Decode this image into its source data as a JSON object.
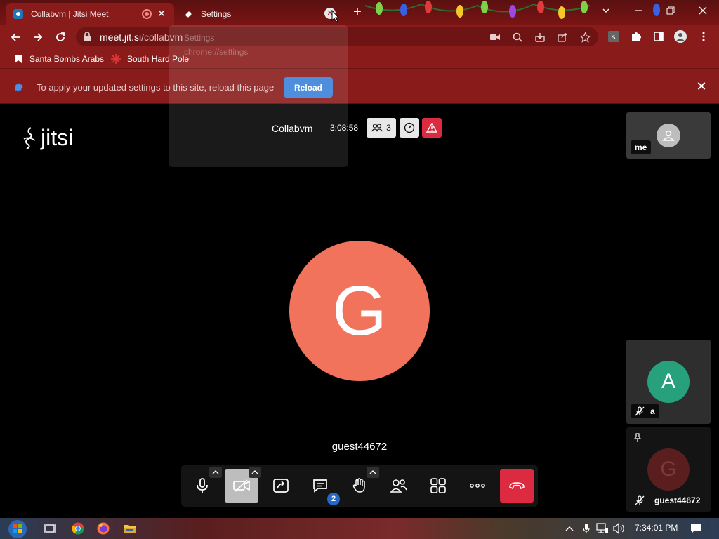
{
  "browser": {
    "tabs": [
      {
        "title": "Collabvm | Jitsi Meet",
        "active": true
      },
      {
        "title": "Settings",
        "active": false
      }
    ],
    "address": {
      "host": "meet.jit.si",
      "path": "/collabvm"
    },
    "bookmarks": [
      {
        "label": "Santa Bombs Arabs",
        "icon": "bookmark-icon"
      },
      {
        "label": "South Hard Pole",
        "icon": "snowflake-icon"
      }
    ],
    "infobar": {
      "message": "To apply your updated settings to this site, reload this page",
      "button": "Reload"
    },
    "ghost": {
      "title": "Settings",
      "url": "chrome://settings"
    }
  },
  "meeting": {
    "title": "Collabvm",
    "duration": "3:08:58",
    "participant_count": "3",
    "dominant": {
      "initial": "G",
      "name": "guest44672",
      "color": "#f2735c"
    },
    "chat_unread": "2"
  },
  "filmstrip": [
    {
      "name": "me",
      "type": "local"
    },
    {
      "name": "a",
      "initial": "A",
      "color": "#26a17b",
      "muted": true
    },
    {
      "name": "guest44672",
      "initial": "G",
      "color": "#5a1e1e",
      "muted": true,
      "pinned": true
    }
  ],
  "taskbar": {
    "time": "7:34:01 PM"
  },
  "colors": {
    "accent_red": "#dc2b40",
    "browser_red": "#8a1b1b",
    "reload_blue": "#3b82d9"
  }
}
